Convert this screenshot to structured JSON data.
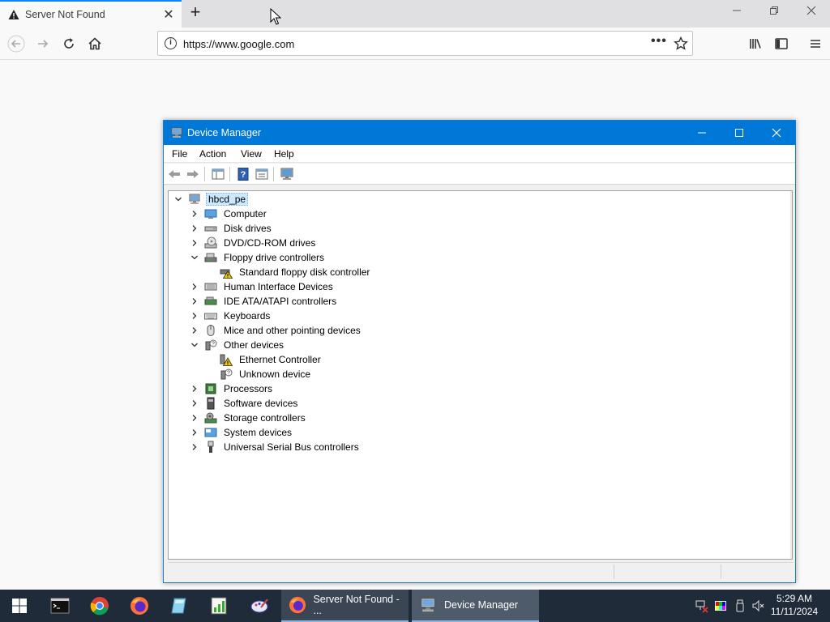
{
  "browser": {
    "tab_title": "Server Not Found",
    "tab_close": "✕",
    "new_tab": "+",
    "url": "https://www.google.com"
  },
  "device_manager": {
    "title": "Device Manager",
    "menu": [
      "File",
      "Action",
      "View",
      "Help"
    ],
    "tree": {
      "root": "hbcd_pe",
      "items": [
        {
          "label": "Computer",
          "expanded": false,
          "icon": "computer-icon"
        },
        {
          "label": "Disk drives",
          "expanded": false,
          "icon": "disk-drive-icon"
        },
        {
          "label": "DVD/CD-ROM drives",
          "expanded": false,
          "icon": "dvd-drive-icon"
        },
        {
          "label": "Floppy drive controllers",
          "expanded": true,
          "icon": "floppy-controller-icon",
          "children": [
            {
              "label": "Standard floppy disk controller",
              "icon": "floppy-warning-icon"
            }
          ]
        },
        {
          "label": "Human Interface Devices",
          "expanded": false,
          "icon": "hid-icon"
        },
        {
          "label": "IDE ATA/ATAPI controllers",
          "expanded": false,
          "icon": "ide-controller-icon"
        },
        {
          "label": "Keyboards",
          "expanded": false,
          "icon": "keyboard-icon"
        },
        {
          "label": "Mice and other pointing devices",
          "expanded": false,
          "icon": "mouse-icon"
        },
        {
          "label": "Other devices",
          "expanded": true,
          "icon": "unknown-device-icon",
          "children": [
            {
              "label": "Ethernet Controller",
              "icon": "ethernet-warning-icon"
            },
            {
              "label": "Unknown device",
              "icon": "unknown-device-icon"
            }
          ]
        },
        {
          "label": "Processors",
          "expanded": false,
          "icon": "processor-icon"
        },
        {
          "label": "Software devices",
          "expanded": false,
          "icon": "software-device-icon"
        },
        {
          "label": "Storage controllers",
          "expanded": false,
          "icon": "storage-controller-icon"
        },
        {
          "label": "System devices",
          "expanded": false,
          "icon": "system-device-icon"
        },
        {
          "label": "Universal Serial Bus controllers",
          "expanded": false,
          "icon": "usb-icon"
        }
      ]
    }
  },
  "taskbar": {
    "apps": [
      {
        "label": "Server Not Found - ...",
        "icon": "firefox-icon",
        "active": false
      },
      {
        "label": "Device Manager",
        "icon": "device-manager-icon",
        "active": true
      }
    ],
    "time": "5:29 AM",
    "date": "11/11/2024"
  },
  "colors": {
    "titlebar": "#0078d7",
    "taskbar": "#1f2b38",
    "selection": "#cce8ff",
    "tab_accent": "#0a84ff"
  }
}
